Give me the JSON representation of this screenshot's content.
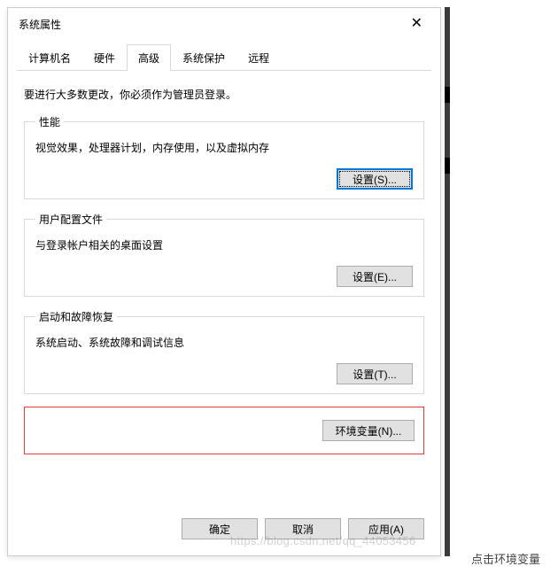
{
  "dialog": {
    "title": "系统属性",
    "close_glyph": "✕"
  },
  "tabs": {
    "items": [
      {
        "label": "计算机名",
        "active": false
      },
      {
        "label": "硬件",
        "active": false
      },
      {
        "label": "高级",
        "active": true
      },
      {
        "label": "系统保护",
        "active": false
      },
      {
        "label": "远程",
        "active": false
      }
    ]
  },
  "intro": "要进行大多数更改，你必须作为管理员登录。",
  "groups": {
    "performance": {
      "legend": "性能",
      "desc": "视觉效果，处理器计划，内存使用，以及虚拟内存",
      "button": "设置(S)..."
    },
    "profiles": {
      "legend": "用户配置文件",
      "desc": "与登录帐户相关的桌面设置",
      "button": "设置(E)..."
    },
    "startup": {
      "legend": "启动和故障恢复",
      "desc": "系统启动、系统故障和调试信息",
      "button": "设置(T)..."
    }
  },
  "env_button": "环境变量(N)...",
  "actions": {
    "ok": "确定",
    "cancel": "取消",
    "apply": "应用(A)"
  },
  "caption": "点击环境变量",
  "watermark": "https://blog.csdn.net/qq_44053456"
}
